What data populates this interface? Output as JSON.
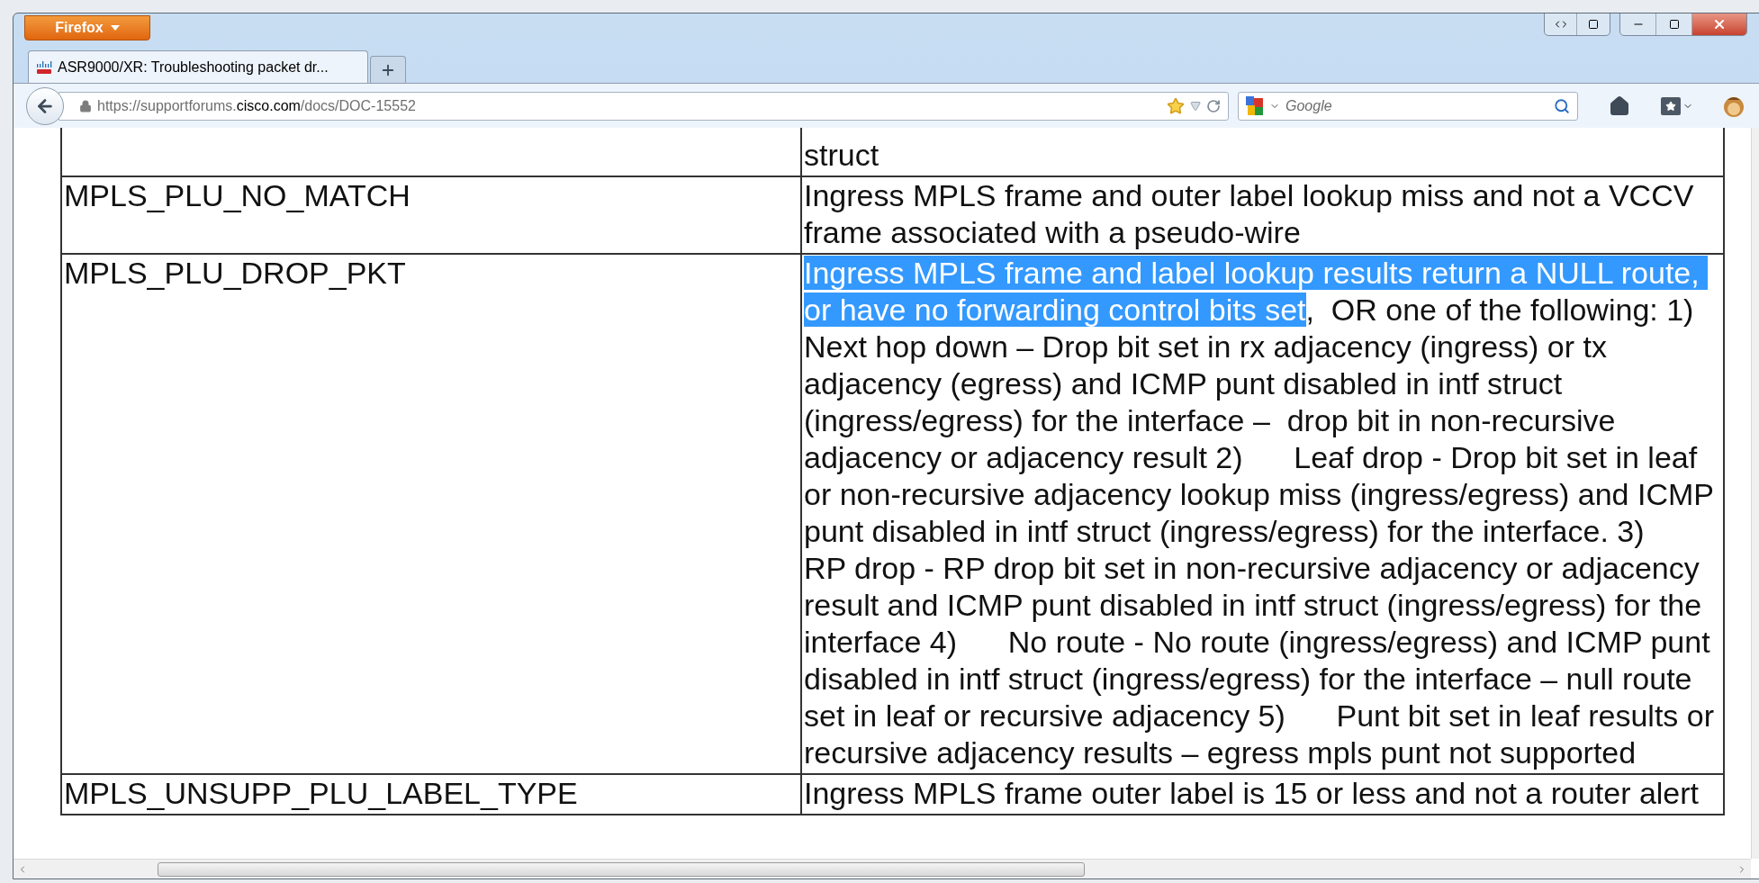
{
  "browser": {
    "menu_button": "Firefox",
    "tabs": [
      {
        "title": "ASR9000/XR: Troubleshooting packet dr...",
        "selected": true
      }
    ],
    "url": [
      {
        "text": "https://supportforums.",
        "emphasis": false
      },
      {
        "text": "cisco.com",
        "emphasis": true
      },
      {
        "text": "/docs/DOC-15552",
        "emphasis": false
      }
    ],
    "search": {
      "placeholder": "Google"
    }
  },
  "table": {
    "rows": [
      {
        "description": [
          {
            "text": "struct",
            "selected": false
          }
        ]
      },
      {
        "name": "MPLS_PLU_NO_MATCH",
        "description": [
          {
            "text": "Ingress MPLS frame and outer label lookup miss and not a VCCV frame associated with a pseudo-wire",
            "selected": false
          }
        ]
      },
      {
        "name": "MPLS_PLU_DROP_PKT",
        "description": [
          {
            "text": "Ingress MPLS frame and label lookup results return a NULL route, or have no forwarding control bits set",
            "selected": true
          },
          {
            "text": ",  OR one of the following: 1)      Next hop down – Drop bit set in rx adjacency (ingress) or tx adjacency (egress) and ICMP punt disabled in intf struct (ingress/egress) for the interface –  drop bit in non-recursive adjacency or adjacency result 2)      Leaf drop - Drop bit set in leaf or non-recursive adjacency lookup miss (ingress/egress) and ICMP punt disabled in intf struct (ingress/egress) for the interface. 3)      RP drop - RP drop bit set in non-recursive adjacency or adjacency result and ICMP punt disabled in intf struct (ingress/egress) for the interface 4)      No route - No route (ingress/egress) and ICMP punt disabled in intf struct (ingress/egress) for the interface – null route set in leaf or recursive adjacency 5)      Punt bit set in leaf results or recursive adjacency results – egress mpls punt not supported",
            "selected": false
          }
        ]
      },
      {
        "name": "MPLS_UNSUPP_PLU_LABEL_TYPE",
        "description": [
          {
            "text": "Ingress MPLS frame outer label is 15 or less and not a router alert",
            "selected": false
          }
        ]
      }
    ]
  }
}
